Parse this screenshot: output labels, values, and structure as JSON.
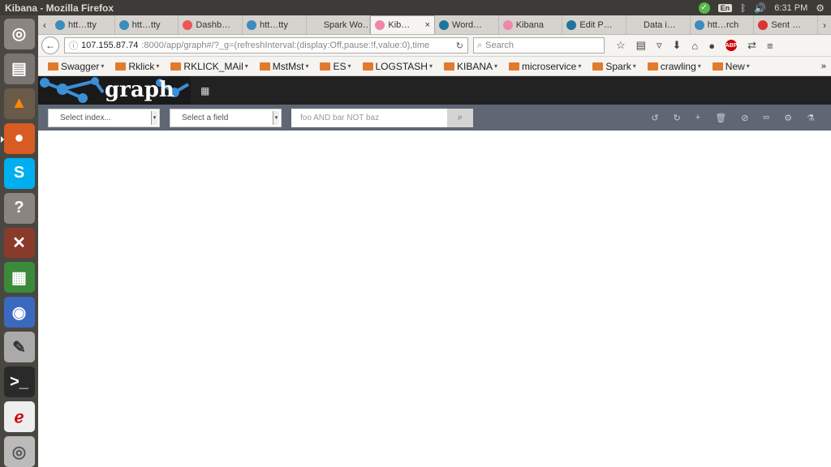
{
  "os": {
    "window_title": "Kibana - Mozilla Firefox",
    "tray": {
      "keyboard": "En",
      "bluetooth": "ᛒ",
      "volume": "🔊",
      "time": "6:31 PM",
      "settings": "⚙"
    }
  },
  "tabs": [
    {
      "label": "htt…tty",
      "favcolor": "#3c8dbc"
    },
    {
      "label": "htt…tty",
      "favcolor": "#3c8dbc"
    },
    {
      "label": "Dashb…",
      "favcolor": "#e55"
    },
    {
      "label": "htt…tty",
      "favcolor": "#3c8dbc"
    },
    {
      "label": "Spark Wo…",
      "favcolor": "transparent"
    },
    {
      "label": "Kib…",
      "favcolor": "#e8a",
      "active": true,
      "close": "×"
    },
    {
      "label": "Word…",
      "favcolor": "#21759b"
    },
    {
      "label": "Kibana",
      "favcolor": "#e8a"
    },
    {
      "label": "Edit P…",
      "favcolor": "#21759b"
    },
    {
      "label": "Data i…",
      "favcolor": "transparent"
    },
    {
      "label": "htt…rch",
      "favcolor": "#3c8dbc"
    },
    {
      "label": "Sent …",
      "favcolor": "#d33"
    }
  ],
  "nav": {
    "url_host": "107.155.87.74",
    "url_rest": ":8000/app/graph#/?_g=(refreshInterval:(display:Off,pause:!f,value:0),time",
    "search_placeholder": "Search"
  },
  "bookmarks": [
    "Swagger",
    "Rklick",
    "RKLICK_MAil",
    "MstMst",
    "ES",
    "LOGSTASH",
    "KIBANA",
    "microservice",
    "Spark",
    "crawling",
    "New"
  ],
  "kibana": {
    "logo_text": "graph",
    "index_select": "Select index...",
    "field_select": "Select a field",
    "query_placeholder": "foo AND bar NOT baz"
  }
}
